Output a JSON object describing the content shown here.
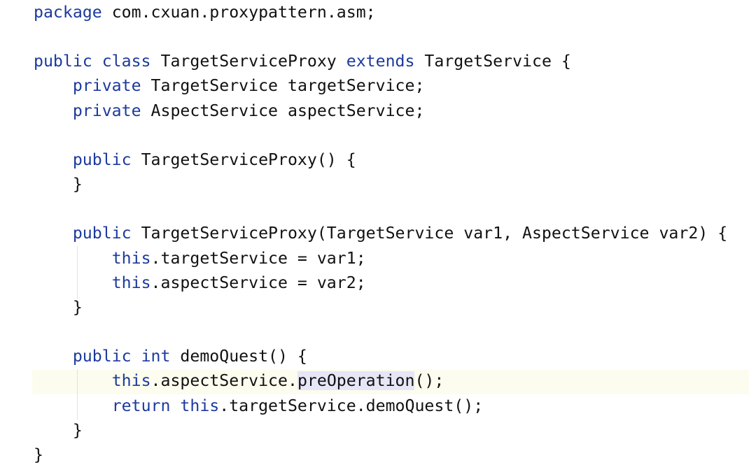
{
  "editor": {
    "language": "java",
    "colors": {
      "keyword": "#1c3a9e",
      "text": "#111111",
      "caret_line": "#fcfcef",
      "usage_highlight": "#e6e6f7"
    },
    "lines": [
      [
        [
          "kw",
          "package"
        ],
        [
          "p",
          " com.cxuan.proxypattern.asm;"
        ]
      ],
      [],
      [
        [
          "kw",
          "public class"
        ],
        [
          "p",
          " TargetServiceProxy "
        ],
        [
          "kw",
          "extends"
        ],
        [
          "p",
          " TargetService {"
        ]
      ],
      [
        [
          "p",
          "    "
        ],
        [
          "kw",
          "private"
        ],
        [
          "p",
          " TargetService targetService;"
        ]
      ],
      [
        [
          "p",
          "    "
        ],
        [
          "kw",
          "private"
        ],
        [
          "p",
          " AspectService aspectService;"
        ]
      ],
      [],
      [
        [
          "p",
          "    "
        ],
        [
          "kw",
          "public"
        ],
        [
          "p",
          " TargetServiceProxy() {"
        ]
      ],
      [
        [
          "p",
          "    }"
        ]
      ],
      [],
      [
        [
          "p",
          "    "
        ],
        [
          "kw",
          "public"
        ],
        [
          "p",
          " TargetServiceProxy(TargetService var1, AspectService var2) {"
        ]
      ],
      [
        [
          "p",
          "        "
        ],
        [
          "kw",
          "this"
        ],
        [
          "p",
          ".targetService = var1;"
        ]
      ],
      [
        [
          "p",
          "        "
        ],
        [
          "kw",
          "this"
        ],
        [
          "p",
          ".aspectService = var2;"
        ]
      ],
      [
        [
          "p",
          "    }"
        ]
      ],
      [],
      [
        [
          "p",
          "    "
        ],
        [
          "kw",
          "public int"
        ],
        [
          "p",
          " demoQuest() {"
        ]
      ],
      [
        [
          "p",
          "        "
        ],
        [
          "kw",
          "this"
        ],
        [
          "p",
          ".aspectService."
        ],
        [
          "hl",
          "preOperation"
        ],
        [
          "p",
          "();"
        ]
      ],
      [
        [
          "p",
          "        "
        ],
        [
          "kw",
          "return this"
        ],
        [
          "p",
          ".targetService.demoQuest();"
        ]
      ],
      [
        [
          "p",
          "    }"
        ]
      ],
      [
        [
          "p",
          "}"
        ]
      ]
    ]
  }
}
